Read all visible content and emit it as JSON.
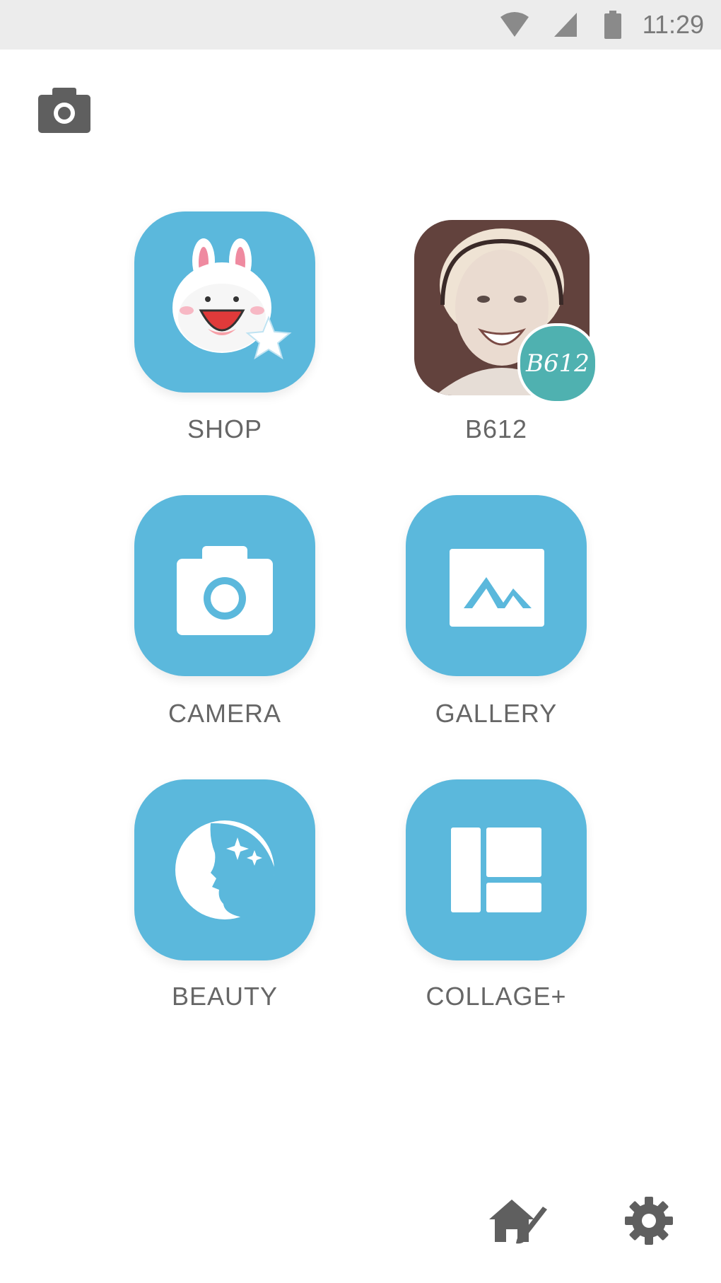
{
  "status_bar": {
    "time": "11:29",
    "icons": [
      "wifi-icon",
      "cell-signal-icon",
      "battery-icon"
    ]
  },
  "header": {
    "icon": "camera-icon"
  },
  "grid": {
    "tiles": [
      {
        "label": "SHOP",
        "icon": "bunny-sticker-icon"
      },
      {
        "label": "B612",
        "icon": "b612-app-icon",
        "badge": "B612"
      },
      {
        "label": "CAMERA",
        "icon": "camera-icon"
      },
      {
        "label": "GALLERY",
        "icon": "gallery-mountain-icon"
      },
      {
        "label": "BEAUTY",
        "icon": "beauty-face-icon"
      },
      {
        "label": "COLLAGE+",
        "icon": "collage-layout-icon"
      }
    ]
  },
  "footer": {
    "icons": [
      "home-brush-icon",
      "settings-gear-icon"
    ]
  },
  "colors": {
    "tile_blue": "#5bb8dc",
    "label_gray": "#666666",
    "status_bar_bg": "#ececec",
    "badge_teal": "#4fb1b0"
  }
}
